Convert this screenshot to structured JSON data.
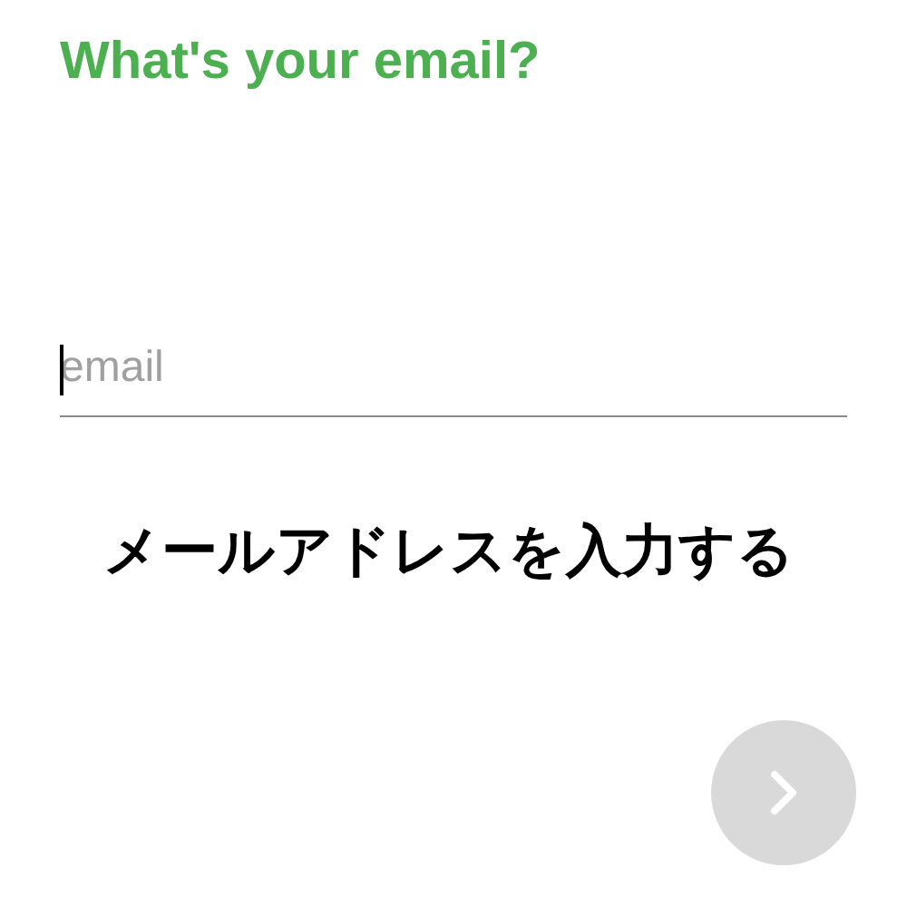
{
  "title": "What's your email?",
  "email_field": {
    "placeholder": "email",
    "focused": true
  },
  "caption": "メールアドレスを入力する",
  "next_button": {
    "disabled": true
  }
}
